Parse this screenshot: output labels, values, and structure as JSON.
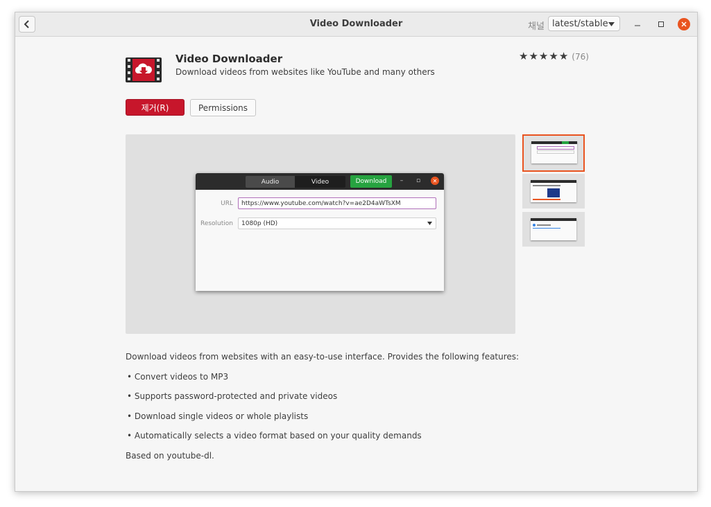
{
  "window": {
    "title": "Video Downloader",
    "channel_label": "채널",
    "channel_value": "latest/stable"
  },
  "app": {
    "name": "Video Downloader",
    "summary": "Download videos from websites like YouTube and many others",
    "rating_stars": 5,
    "rating_count": "(76)"
  },
  "actions": {
    "remove_label": "제거(R)",
    "permissions_label": "Permissions"
  },
  "screenshot": {
    "tab_audio": "Audio",
    "tab_video": "Video",
    "download_label": "Download",
    "url_label": "URL",
    "url_value": "https://www.youtube.com/watch?v=ae2D4aWTsXM",
    "resolution_label": "Resolution",
    "resolution_value": "1080p (HD)"
  },
  "thumbnails_count": 3,
  "description": {
    "intro": "Download videos from websites with an easy-to-use interface. Provides the following features:",
    "features": [
      "• Convert videos to MP3",
      "• Supports password-protected and private videos",
      "• Download single videos or whole playlists",
      "• Automatically selects a video format based on your quality demands"
    ],
    "footer": "Based on youtube-dl."
  },
  "colors": {
    "accent_orange": "#e95420",
    "remove_red": "#c7162b",
    "download_green": "#26a340"
  }
}
